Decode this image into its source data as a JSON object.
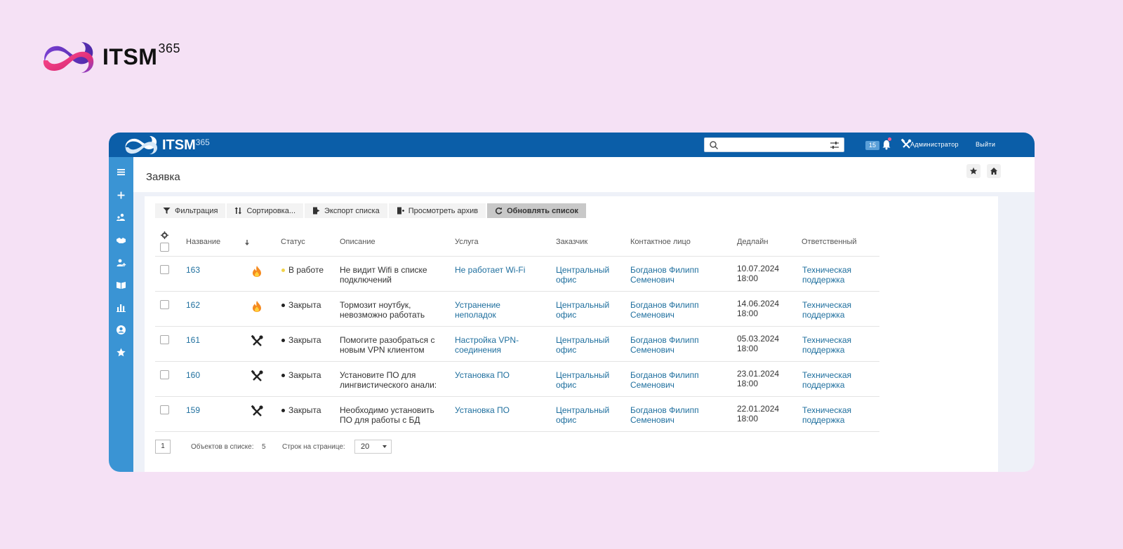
{
  "brand": {
    "name": "ITSM",
    "sup": "365"
  },
  "app": {
    "logo": {
      "name": "ITSM",
      "sup": "365"
    },
    "search": {
      "value": "",
      "placeholder": ""
    },
    "notifications_count": "15",
    "user_link": "Администратор",
    "logout_link": "Выйти",
    "colors": {
      "topbar": "#0b5ea8",
      "sidebar": "#3a94d4",
      "link": "#1f6f9e"
    }
  },
  "sidebar": {
    "icons": [
      "menu-icon",
      "plus-icon",
      "users-icon",
      "handshake-icon",
      "add-user-icon",
      "book-icon",
      "bar-chart-icon",
      "account-icon",
      "star-icon"
    ]
  },
  "page": {
    "title": "Заявка"
  },
  "toolbar": {
    "filter": "Фильтрация",
    "sort": "Сортировка...",
    "export": "Экспорт списка",
    "archive": "Просмотреть архив",
    "refresh": "Обновлять список"
  },
  "table": {
    "headers": {
      "name": "Название",
      "status": "Статус",
      "desc": "Описание",
      "service": "Услуга",
      "customer": "Заказчик",
      "contact": "Контактное лицо",
      "deadline": "Дедлайн",
      "responsible": "Ответственный"
    },
    "rows": [
      {
        "id": "163",
        "priority_icon": "fire-icon",
        "status": "В работе",
        "status_color": "#f2d34a",
        "desc1": "Не видит Wifi в списке",
        "desc2": "подключений",
        "svc1": "Не работает Wi-Fi",
        "svc2": "",
        "cust1": "Центральный",
        "cust2": "офис",
        "contact1": "Богданов Филипп",
        "contact2": "Семенович",
        "date": "10.07.2024",
        "time": "18:00",
        "resp1": "Техническая",
        "resp2": "поддержка"
      },
      {
        "id": "162",
        "priority_icon": "fire-icon",
        "status": "Закрыта",
        "status_color": "#222222",
        "desc1": "Тормозит ноутбук,",
        "desc2": "невозможно работать",
        "svc1": "Устранение",
        "svc2": "неполадок",
        "cust1": "Центральный",
        "cust2": "офис",
        "contact1": "Богданов Филипп",
        "contact2": "Семенович",
        "date": "14.06.2024",
        "time": "18:00",
        "resp1": "Техническая",
        "resp2": "поддержка"
      },
      {
        "id": "161",
        "priority_icon": "tools-icon",
        "status": "Закрыта",
        "status_color": "#222222",
        "desc1": "Помогите разобраться с",
        "desc2": "новым VPN клиентом",
        "svc1": "Настройка VPN-",
        "svc2": "соединения",
        "cust1": "Центральный",
        "cust2": "офис",
        "contact1": "Богданов Филипп",
        "contact2": "Семенович",
        "date": "05.03.2024",
        "time": "18:00",
        "resp1": "Техническая",
        "resp2": "поддержка"
      },
      {
        "id": "160",
        "priority_icon": "tools-icon",
        "status": "Закрыта",
        "status_color": "#222222",
        "desc1": "Установите ПО для",
        "desc2": "лингвистического анали:",
        "svc1": "Установка ПО",
        "svc2": "",
        "cust1": "Центральный",
        "cust2": "офис",
        "contact1": "Богданов Филипп",
        "contact2": "Семенович",
        "date": "23.01.2024",
        "time": "18:00",
        "resp1": "Техническая",
        "resp2": "поддержка"
      },
      {
        "id": "159",
        "priority_icon": "tools-icon",
        "status": "Закрыта",
        "status_color": "#222222",
        "desc1": "Необходимо установить",
        "desc2": "ПО для работы с БД",
        "svc1": "Установка ПО",
        "svc2": "",
        "cust1": "Центральный",
        "cust2": "офис",
        "contact1": "Богданов Филипп",
        "contact2": "Семенович",
        "date": "22.01.2024",
        "time": "18:00",
        "resp1": "Техническая",
        "resp2": "поддержка"
      }
    ]
  },
  "footer": {
    "page": "1",
    "count_label": "Объектов в списке:",
    "count": "5",
    "rows_label": "Строк на странице:",
    "rows_per_page": "20"
  }
}
